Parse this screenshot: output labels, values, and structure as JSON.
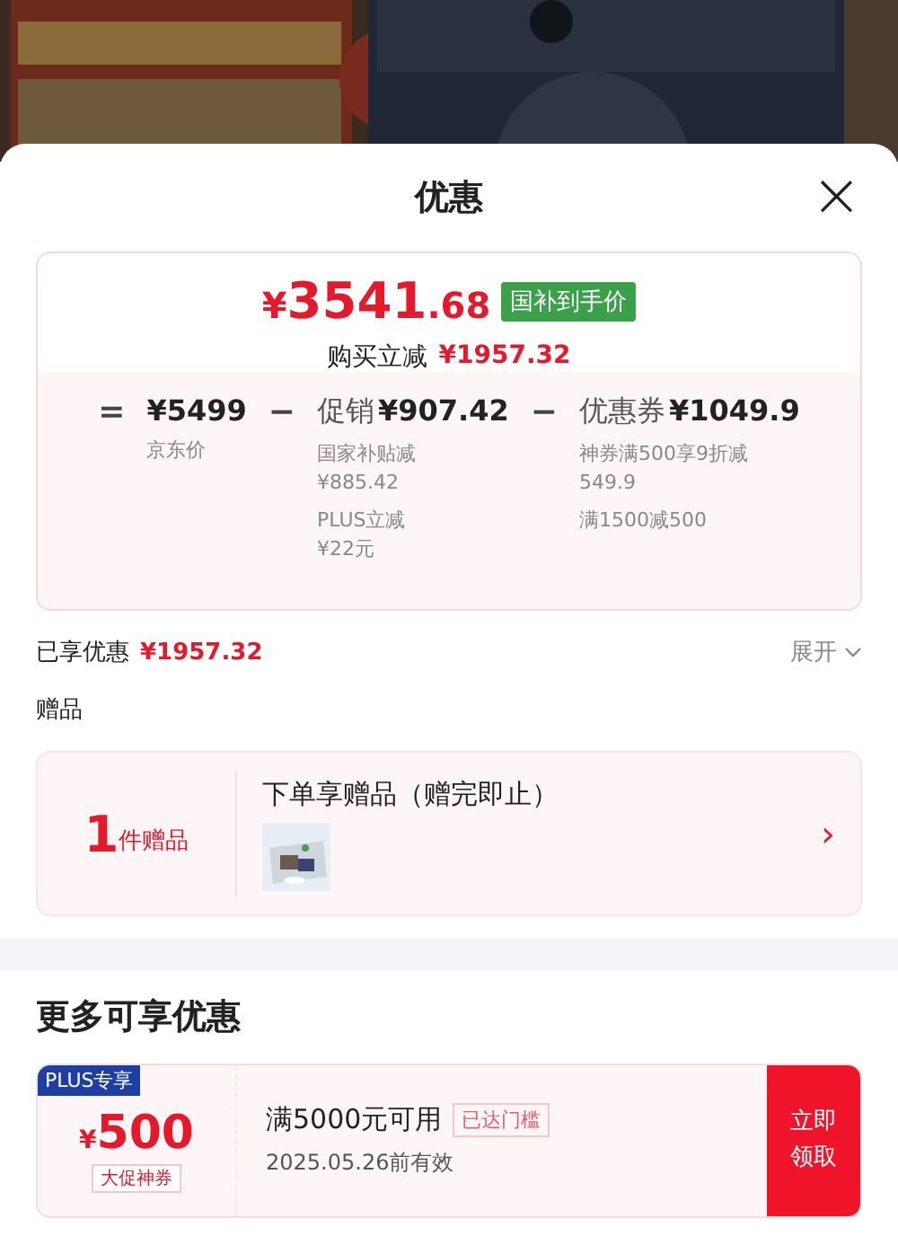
{
  "sheet": {
    "title": "优惠",
    "close": "×"
  },
  "price_card": {
    "currency": "¥",
    "integer": "3541",
    "decimal": ".68",
    "tag": "国补到手价",
    "saving_label": "购买立减",
    "saving": "¥1957.32",
    "breakdown": [
      {
        "op": "=",
        "amount": "¥5499",
        "notes": [
          {
            "lines": [
              "京东价"
            ]
          }
        ]
      },
      {
        "op": "−",
        "amount": "¥907.42",
        "label": "促销",
        "notes": [
          {
            "lines": [
              "国家补贴减",
              "¥885.42"
            ]
          },
          {
            "lines": [
              "PLUS立减",
              "¥22元"
            ]
          }
        ]
      },
      {
        "op": "−",
        "amount": "¥1049.9",
        "label": "优惠券",
        "notes": [
          {
            "lines": [
              "神券满500享9折减",
              "549.9"
            ]
          },
          {
            "lines": [
              "满1500减500"
            ]
          }
        ]
      }
    ]
  },
  "enjoyed": {
    "label": "已享优惠",
    "amount": "¥1957.32",
    "toggle": "展开",
    "expanded": false
  },
  "gifts": {
    "heading": "赠品",
    "count": "1",
    "unit": "件赠品",
    "title": "下单享赠品（赠完即止）",
    "arrow": "›"
  },
  "more": {
    "heading": "更多可享优惠",
    "coupons": [
      {
        "badge": "PLUS专享",
        "currency": "¥",
        "amount": "500",
        "tag": "大促神券",
        "condition": "满5000元可用",
        "status": "已达门槛",
        "validity": "2025.05.26前有效",
        "button": "立即领取"
      }
    ]
  }
}
